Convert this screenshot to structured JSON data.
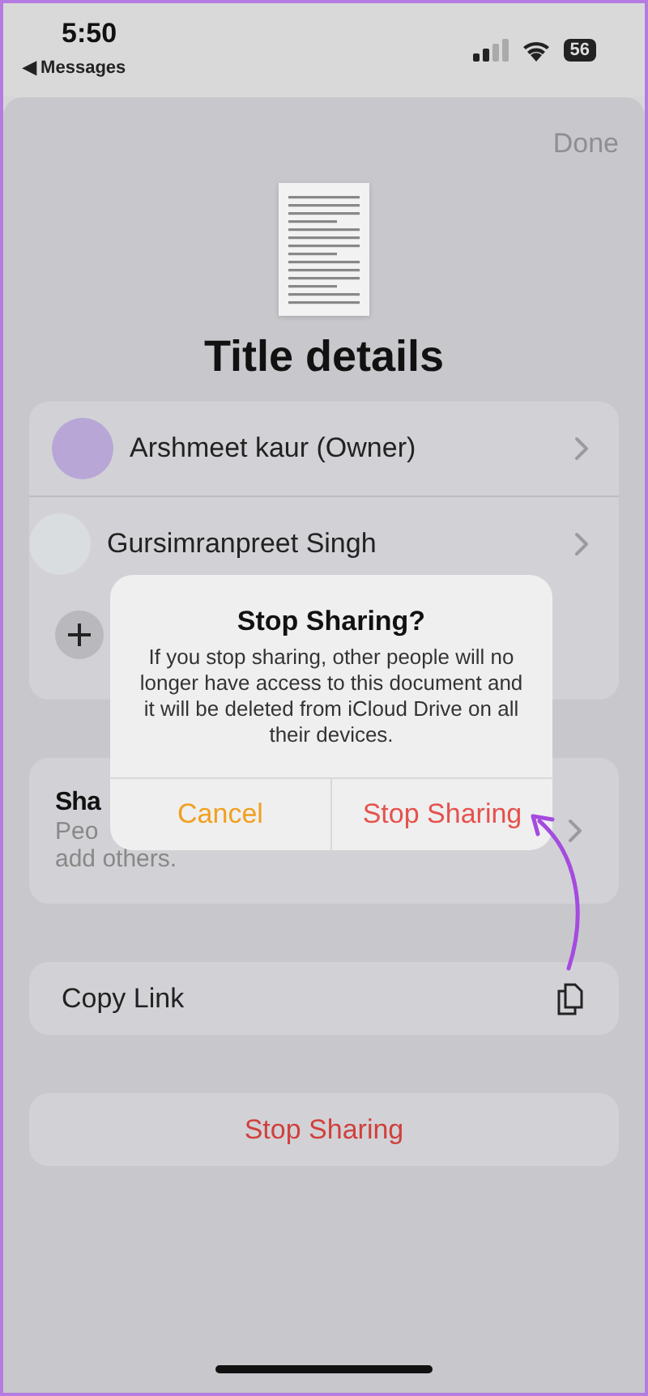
{
  "status_bar": {
    "time": "5:50",
    "back_label": "◀ Messages",
    "battery": "56"
  },
  "sheet": {
    "done": "Done",
    "title": "Title details",
    "participants": [
      {
        "name": "Arshmeet kaur (Owner)"
      },
      {
        "name": "Gursimranpreet Singh"
      }
    ],
    "share_options": {
      "title": "Sha",
      "lines": [
        "Peo",
        "add others."
      ]
    },
    "copy_link": "Copy Link",
    "stop_sharing": "Stop Sharing"
  },
  "alert": {
    "title": "Stop Sharing?",
    "message": "If you stop sharing, other people will no longer have access to this document and it will be deleted from iCloud Drive on all their devices.",
    "buttons": [
      {
        "label": "Cancel",
        "kind": "cancel"
      },
      {
        "label": "Stop Sharing",
        "kind": "destructive"
      }
    ]
  }
}
